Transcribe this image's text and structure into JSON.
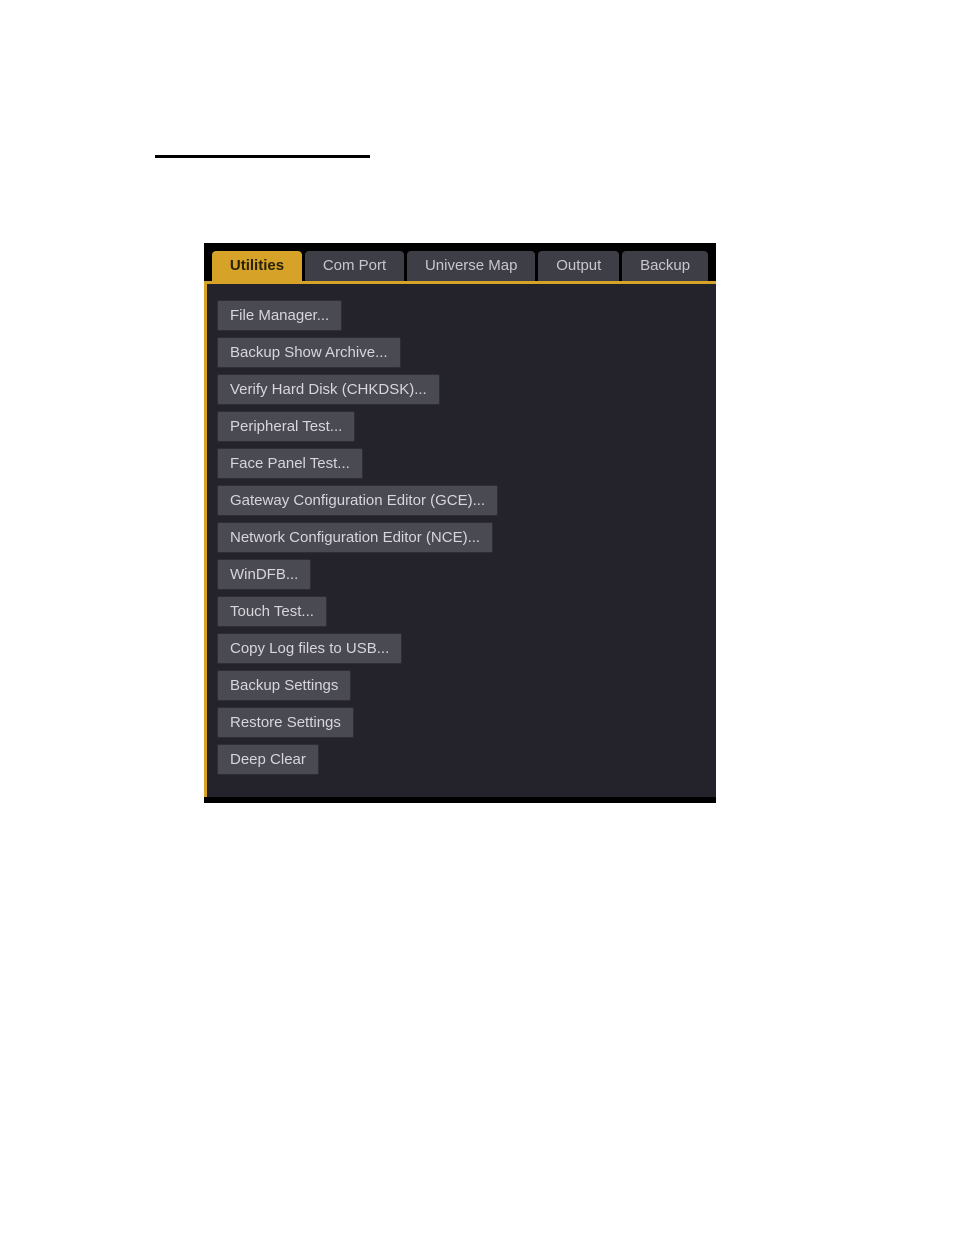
{
  "tabs": [
    {
      "label": "Utilities",
      "active": true
    },
    {
      "label": "Com Port",
      "active": false
    },
    {
      "label": "Universe Map",
      "active": false
    },
    {
      "label": "Output",
      "active": false
    },
    {
      "label": "Backup",
      "active": false
    }
  ],
  "buttons": [
    "File Manager...",
    "Backup Show Archive...",
    "Verify Hard Disk (CHKDSK)...",
    "Peripheral Test...",
    "Face Panel Test...",
    "Gateway Configuration Editor (GCE)...",
    "Network Configuration Editor (NCE)...",
    "WinDFB...",
    "Touch Test...",
    "Copy Log files to USB...",
    "Backup Settings",
    "Restore Settings",
    "Deep Clear"
  ],
  "colors": {
    "accent": "#d6a227",
    "panel_bg": "#24232b",
    "button_bg": "#4a4a52",
    "tab_bg": "#3e3e46"
  }
}
